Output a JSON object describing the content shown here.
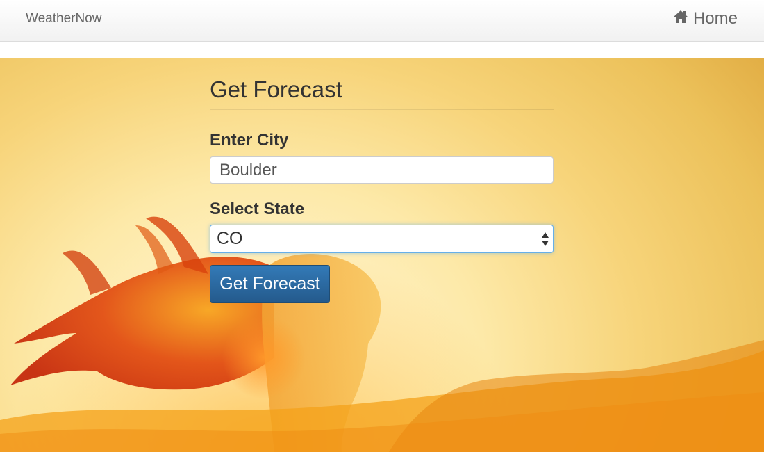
{
  "navbar": {
    "brand": "WeatherNow",
    "home_label": "Home",
    "home_icon": "home-icon"
  },
  "form": {
    "title": "Get Forecast",
    "city_label": "Enter City",
    "city_value": "Boulder",
    "state_label": "Select State",
    "state_selected": "CO",
    "submit_label": "Get Forecast"
  },
  "colors": {
    "button": "#337ab7",
    "focus_border": "#66afe9",
    "navbar_text": "#666666"
  }
}
